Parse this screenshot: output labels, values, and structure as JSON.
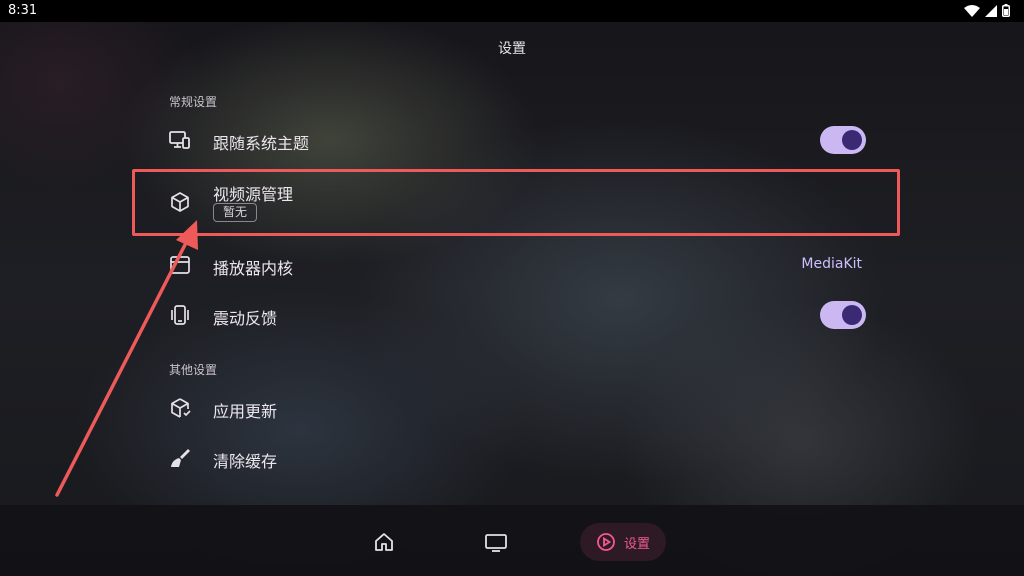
{
  "status_bar": {
    "time": "8:31",
    "icons": [
      "wifi-icon",
      "signal-icon",
      "battery-icon"
    ]
  },
  "header": {
    "title": "设置"
  },
  "sections": {
    "general": {
      "title": "常规设置",
      "items": [
        {
          "label": "跟随系统主题",
          "icon": "monitor-phone-icon",
          "control": "toggle",
          "on": true
        },
        {
          "label": "视频源管理",
          "icon": "cube-icon",
          "badge": "暂无"
        },
        {
          "label": "播放器内核",
          "icon": "player-window-icon",
          "value": "MediaKit"
        },
        {
          "label": "震动反馈",
          "icon": "vibration-icon",
          "control": "toggle",
          "on": true
        }
      ]
    },
    "other": {
      "title": "其他设置",
      "items": [
        {
          "label": "应用更新",
          "icon": "package-update-icon"
        },
        {
          "label": "清除缓存",
          "icon": "broom-icon"
        }
      ]
    }
  },
  "nav": {
    "items": [
      {
        "icon": "home-icon"
      },
      {
        "icon": "tv-icon"
      },
      {
        "icon": "settings-icon",
        "label": "设置",
        "active": true
      }
    ]
  },
  "colors": {
    "accent": "#f15b8c",
    "toggle_track": "#cbb8f3",
    "toggle_knob": "#3a2a73",
    "value_text": "#cdbdff",
    "annotation": "#ee5a5a"
  }
}
